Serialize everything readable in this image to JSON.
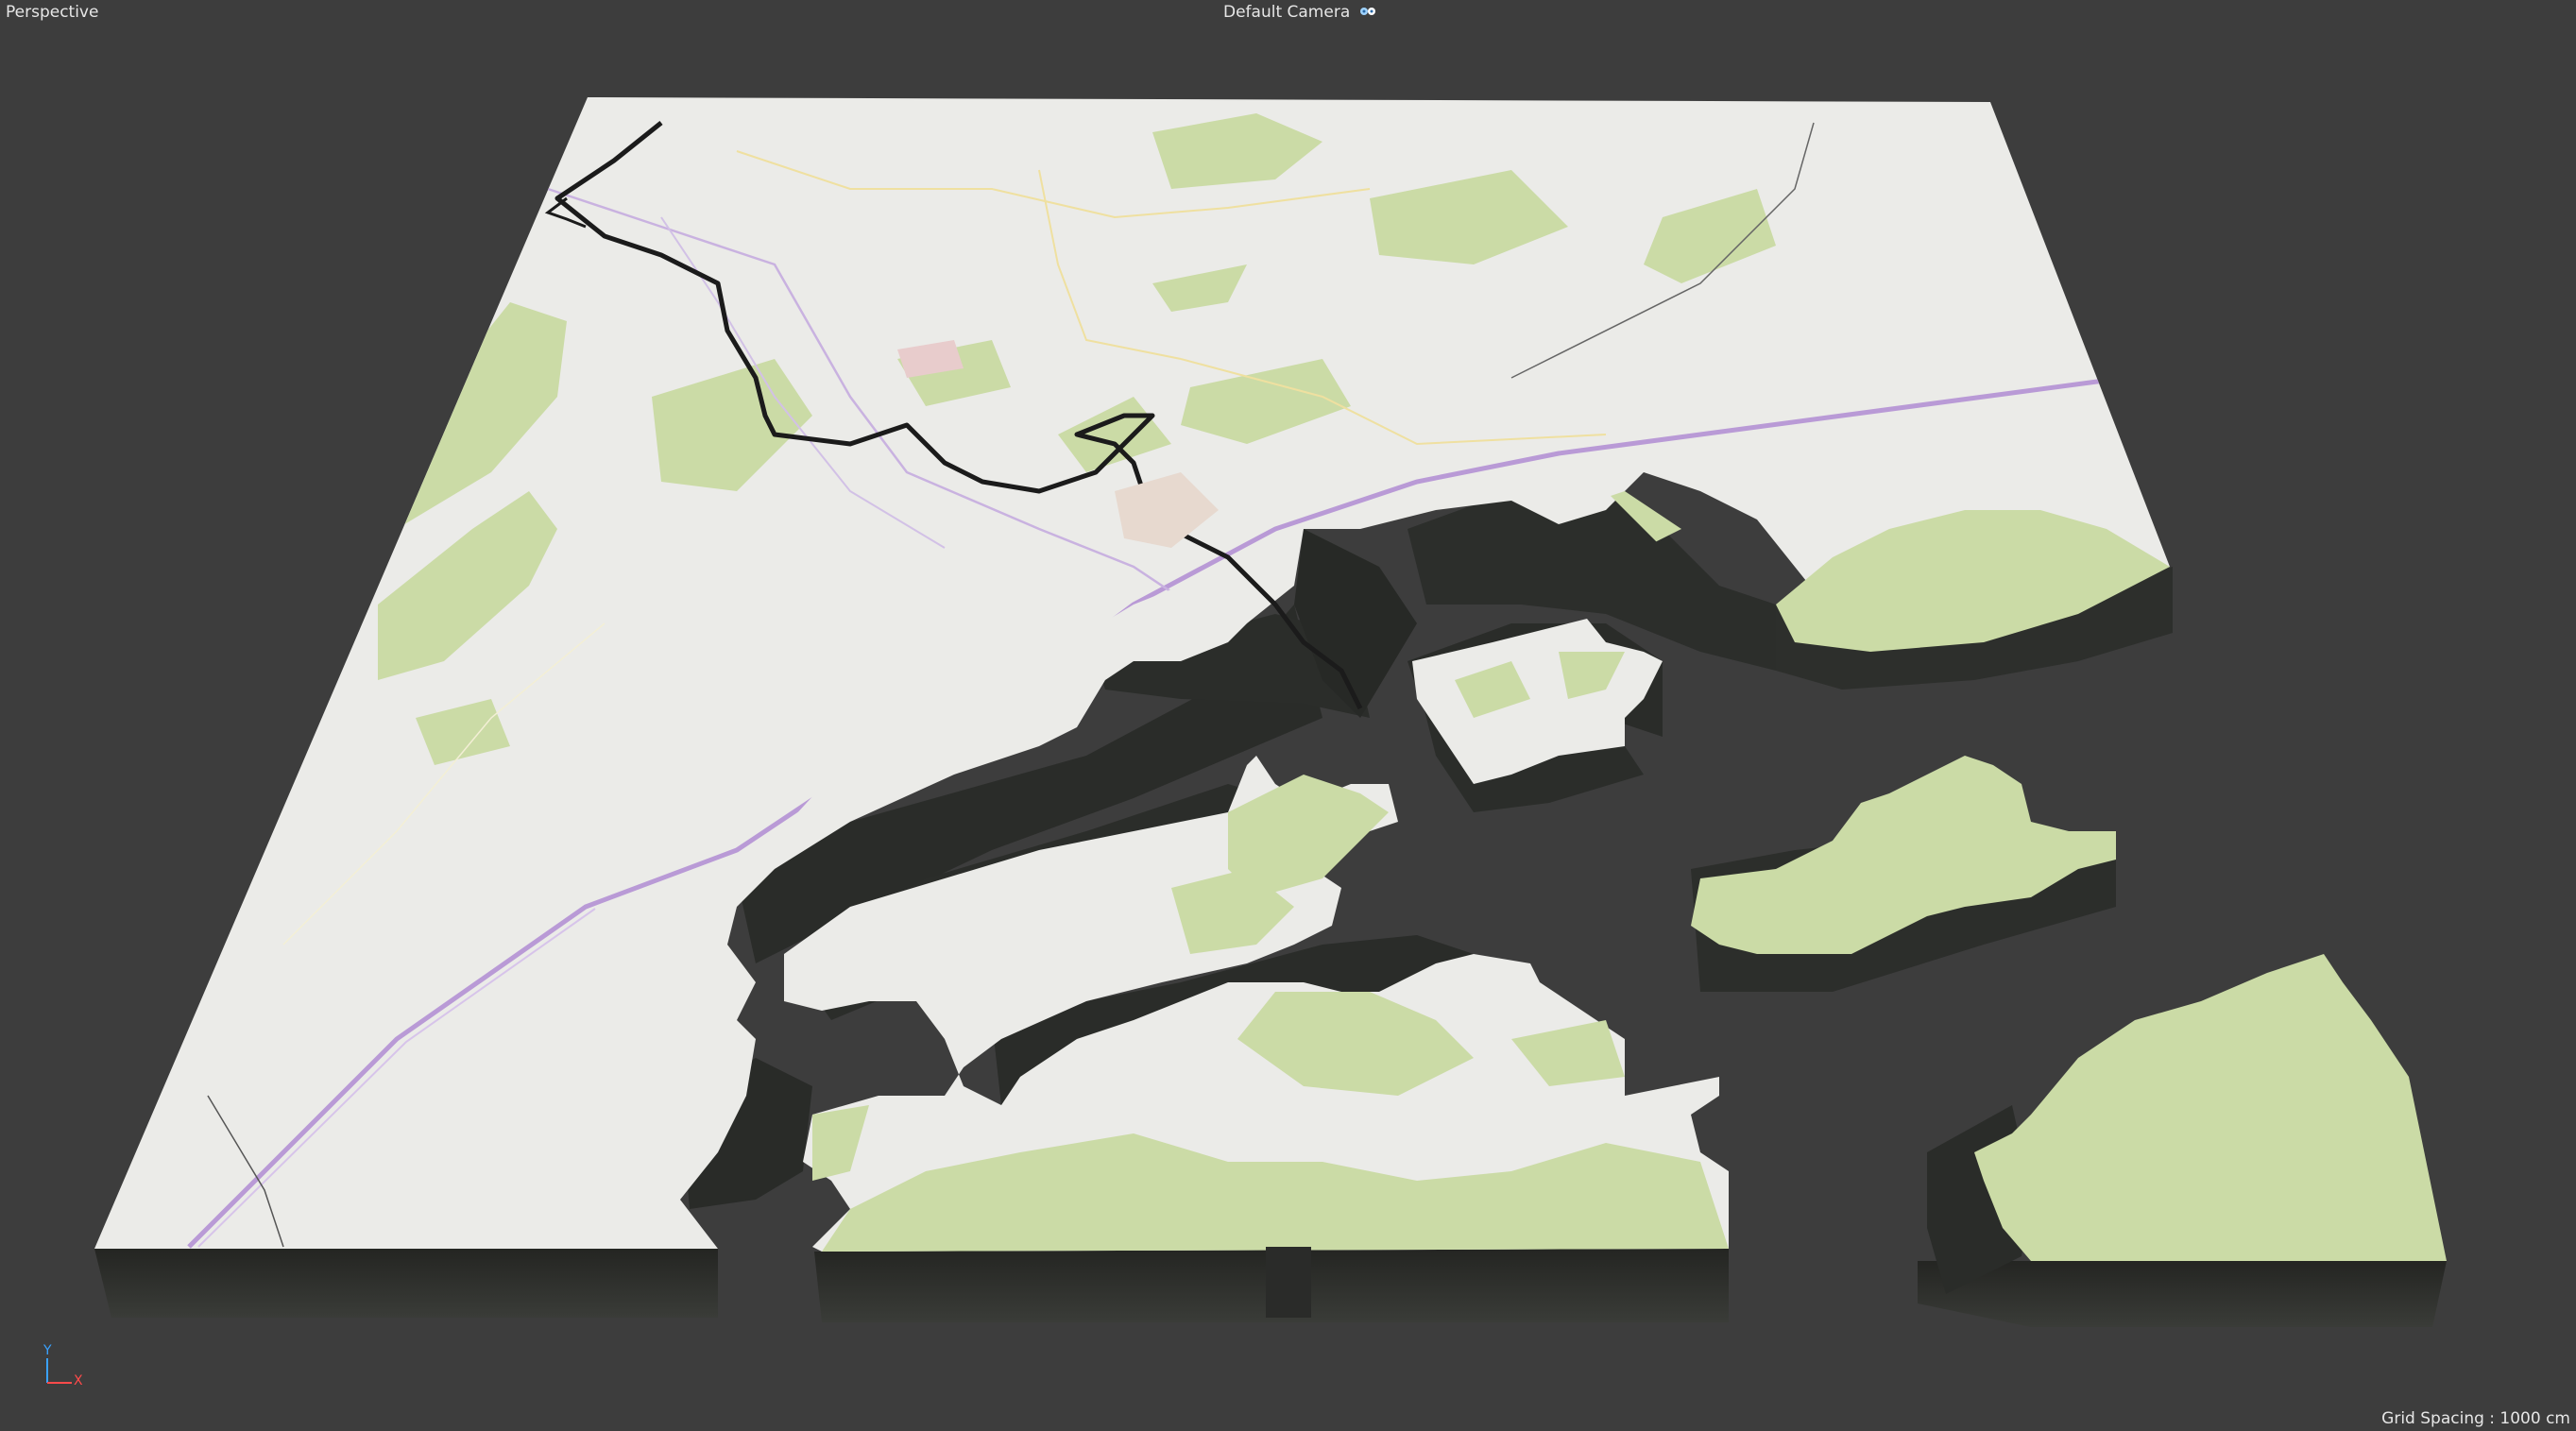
{
  "viewport": {
    "mode_label": "Perspective",
    "camera_label": "Default Camera",
    "camera_icon": "camera-icon",
    "grid_spacing": "Grid Spacing : 1000 cm",
    "axis": {
      "y": "Y",
      "x": "X"
    }
  },
  "colors": {
    "background": "#3d3d3d",
    "map_land": "#ebebe8",
    "map_forest": "#cbdba6",
    "extrusion_side": "#2e302d",
    "motorway": "#b99ad6",
    "minor_road": "#f4e7a4",
    "river": "#1b1b1b"
  }
}
